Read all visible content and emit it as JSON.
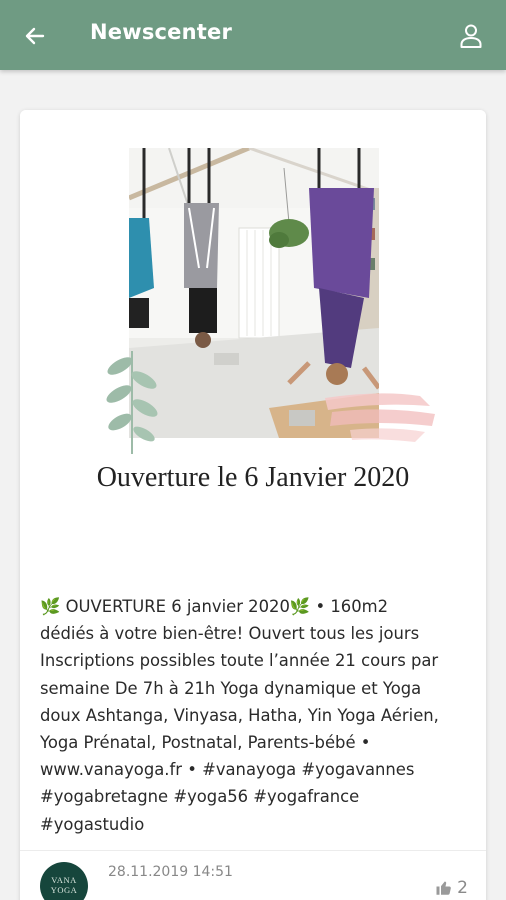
{
  "appbar": {
    "title": "Newscenter",
    "background": "#6f9b83",
    "back_icon": "arrow-left-icon",
    "profile_icon": "user-icon"
  },
  "post": {
    "image_headline": "Ouverture le 6 Janvier 2020",
    "body_lines": [
      "🌿 OUVERTURE 6 janvier 2020🌿  • 160m2",
      "dédiés à votre bien-être! Ouvert tous les jours",
      "Inscriptions possibles toute l’année 21 cours par",
      "semaine De 7h à 21h Yoga dynamique et Yoga",
      "doux Ashtanga, Vinyasa, Hatha, Yin Yoga Aérien,",
      "Yoga Prénatal, Postnatal, Parents-bébé •",
      "www.vanayoga.fr • #vanayoga #yogavannes",
      "#yogabretagne #yoga56 #yogafrance",
      "#yogastudio"
    ],
    "author_avatar_text": "VANA YOGA",
    "timestamp": "28.11.2019 14:51",
    "like_count": "2",
    "like_icon": "thumbs-up-icon"
  }
}
